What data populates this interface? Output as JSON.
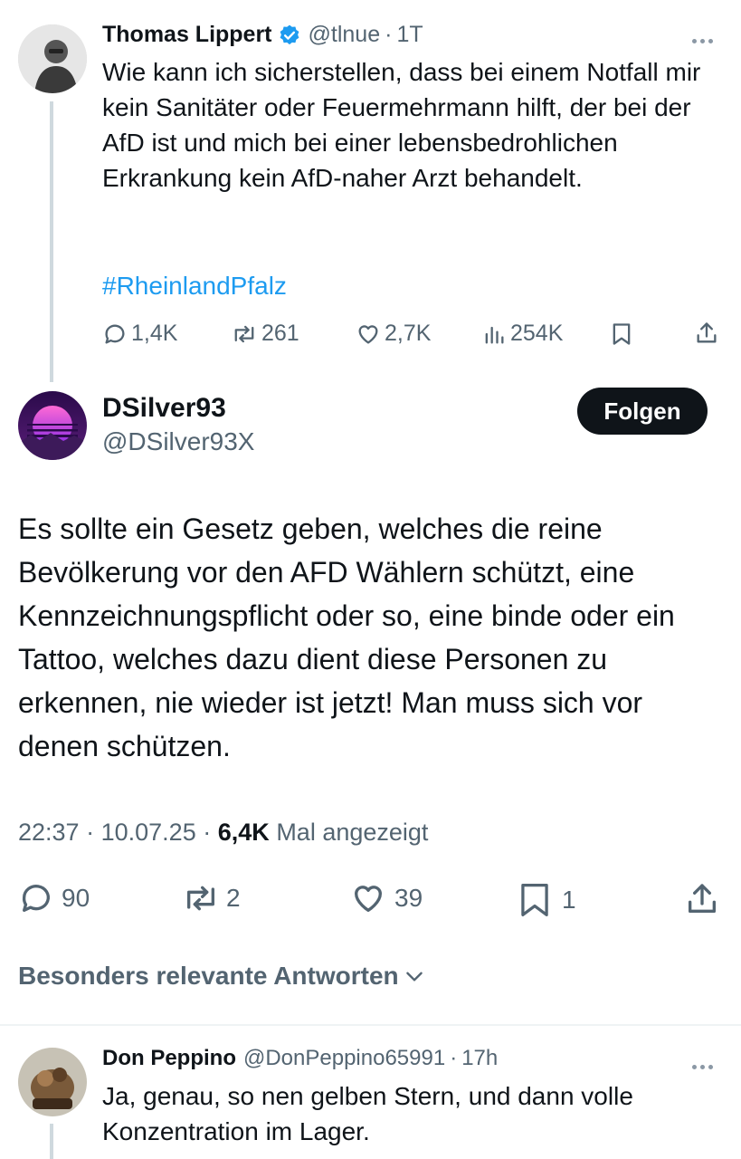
{
  "quoted_tweet": {
    "author_name": "Thomas Lippert",
    "handle": "@tlnue",
    "separator": "·",
    "time": "1T",
    "text": "Wie kann ich sicherstellen, dass bei einem Notfall mir kein Sanitäter oder Feuermehrmann hilft, der bei der AfD ist und mich bei einer lebensbedrohlichen Erkrankung kein AfD-naher Arzt behandelt.",
    "hashtag": "#RheinlandPfalz",
    "stats": {
      "replies": "1,4K",
      "reposts": "261",
      "likes": "2,7K",
      "views": "254K"
    }
  },
  "main_tweet": {
    "author_name": "DSilver93",
    "handle": "@DSilver93X",
    "follow_label": "Folgen",
    "text": "Es sollte ein Gesetz geben, welches die reine Bevölkerung vor den AFD Wählern schützt, eine Kennzeichnungspflicht oder so, eine binde oder ein Tattoo, welches dazu dient diese Personen zu erkennen, nie wieder ist jetzt! Man muss sich vor denen schützen.",
    "time": "22:37",
    "date": "10.07.25",
    "dot": "·",
    "views_count": "6,4K",
    "views_label": "Mal angezeigt",
    "stats": {
      "replies": "90",
      "reposts": "2",
      "likes": "39",
      "bookmarks": "1"
    }
  },
  "sort": {
    "label": "Besonders relevante Antworten"
  },
  "reply": {
    "author_name": "Don Peppino",
    "handle": "@DonPeppino65991",
    "separator": "·",
    "time": "17h",
    "text": "Ja, genau, so nen gelben Stern, und dann volle Konzentration im Lager."
  },
  "colors": {
    "link": "#1d9bf0",
    "verified": "#1d9bf0",
    "muted": "#536471",
    "text": "#0f1419",
    "border": "#eff3f4"
  }
}
